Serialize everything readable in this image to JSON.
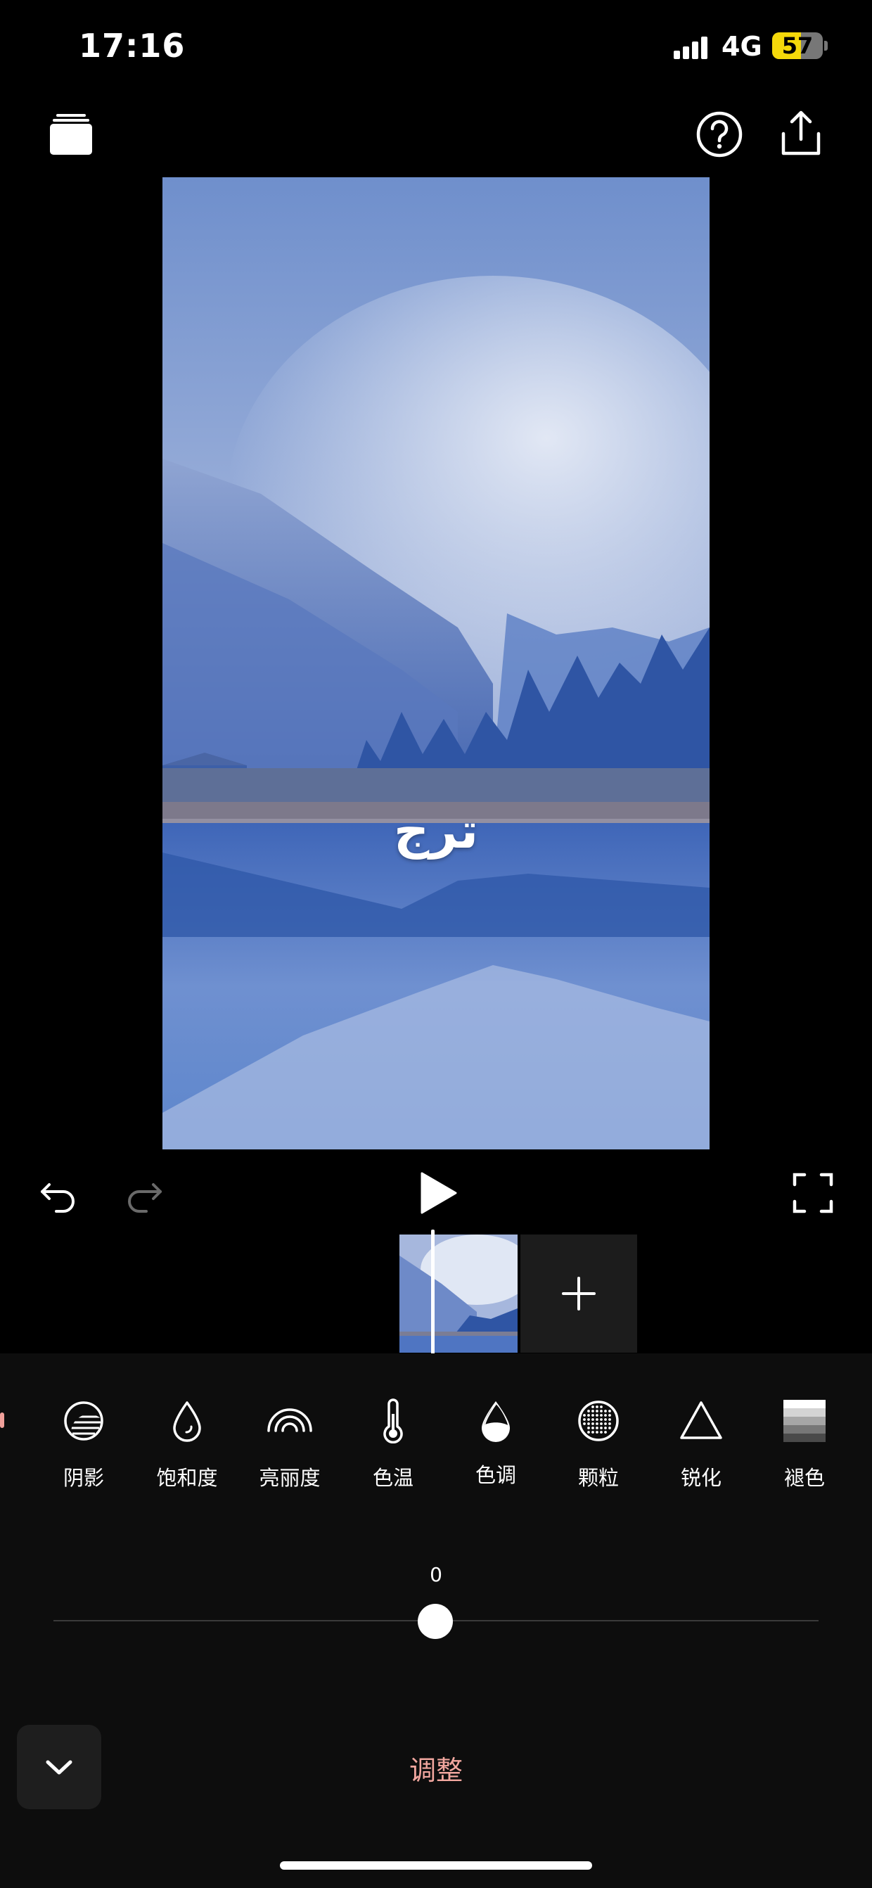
{
  "status_bar": {
    "time": "17:16",
    "network": "4G",
    "battery": "57",
    "battery_level": 0.57
  },
  "top_bar": {
    "left_icon": "layers-icon",
    "help_icon": "help-icon",
    "export_icon": "share-icon"
  },
  "preview": {
    "overlay_text": "ترج"
  },
  "controls": {
    "undo_icon": "undo-icon",
    "redo_icon": "redo-icon",
    "play_icon": "play-icon",
    "fullscreen_icon": "fullscreen-icon"
  },
  "timeline": {
    "add_icon": "plus-icon"
  },
  "tools": [
    {
      "label": "阴影",
      "icon": "shadow-icon"
    },
    {
      "label": "饱和度",
      "icon": "saturation-icon"
    },
    {
      "label": "亮丽度",
      "icon": "vibrance-icon"
    },
    {
      "label": "色温",
      "icon": "thermometer-icon"
    },
    {
      "label": "色调",
      "icon": "tint-icon"
    },
    {
      "label": "颗粒",
      "icon": "grain-icon"
    },
    {
      "label": "锐化",
      "icon": "sharpen-icon"
    },
    {
      "label": "褪色",
      "icon": "fade-icon"
    }
  ],
  "slider": {
    "value": "0"
  },
  "panel": {
    "title": "调整",
    "collapse_icon": "chevron-down-icon"
  },
  "colors": {
    "accent": "#f2a79f",
    "panel_bg": "#0d0d0d",
    "battery": "#f5d90a"
  }
}
